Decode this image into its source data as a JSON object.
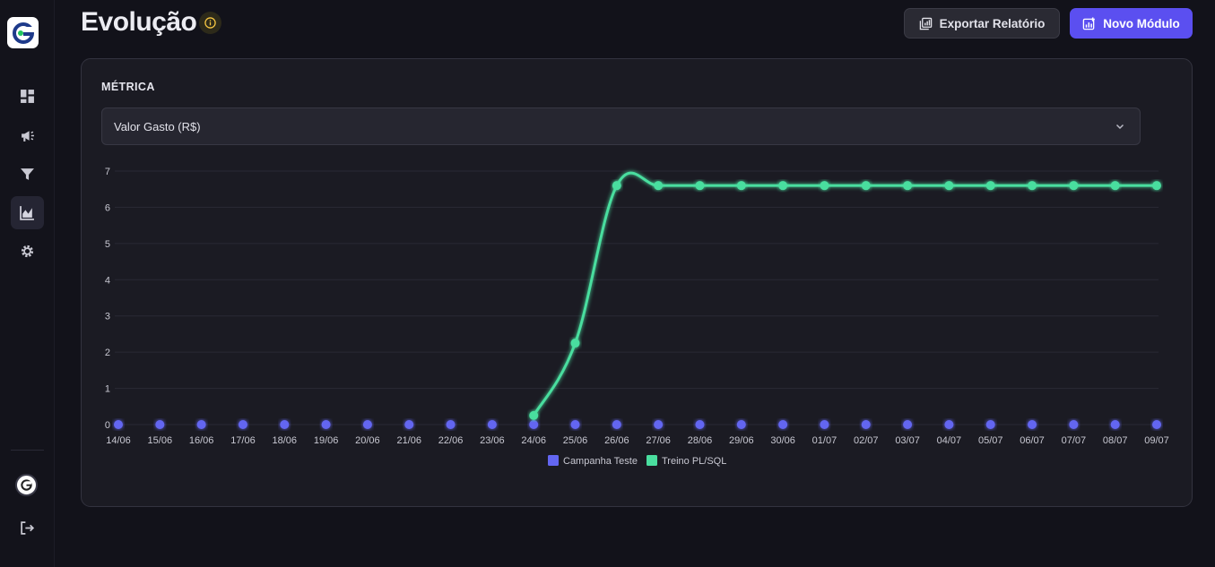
{
  "app": {
    "logo_letter": "G"
  },
  "sidebar": {
    "items": [
      {
        "icon": "dashboard-icon",
        "active": false
      },
      {
        "icon": "megaphone-icon",
        "active": false
      },
      {
        "icon": "filter-icon",
        "active": false
      },
      {
        "icon": "chart-area-icon",
        "active": true
      },
      {
        "icon": "gear-icon",
        "active": false
      }
    ],
    "avatar_letter": "G",
    "logout_icon": "logout-icon"
  },
  "header": {
    "title": "Evolução",
    "export_label": "Exportar Relatório",
    "new_module_label": "Novo Módulo"
  },
  "metric": {
    "label": "MÉTRICA",
    "selected": "Valor Gasto (R$)"
  },
  "colors": {
    "accent": "#5b4ff0",
    "series_campaign": "#6366f1",
    "series_training": "#4ade9f"
  },
  "chart_data": {
    "type": "line",
    "categories": [
      "14/06",
      "15/06",
      "16/06",
      "17/06",
      "18/06",
      "19/06",
      "20/06",
      "21/06",
      "22/06",
      "23/06",
      "24/06",
      "25/06",
      "26/06",
      "27/06",
      "28/06",
      "29/06",
      "30/06",
      "01/07",
      "02/07",
      "03/07",
      "04/07",
      "05/07",
      "06/07",
      "07/07",
      "08/07",
      "09/07"
    ],
    "series": [
      {
        "name": "Campanha Teste",
        "color": "#6366f1",
        "values": [
          0,
          0,
          0,
          0,
          0,
          0,
          0,
          0,
          0,
          0,
          0,
          0,
          0,
          0,
          0,
          0,
          0,
          0,
          0,
          0,
          0,
          0,
          0,
          0,
          0,
          0
        ]
      },
      {
        "name": "Treino PL/SQL",
        "color": "#4ade9f",
        "values": [
          null,
          null,
          null,
          null,
          null,
          null,
          null,
          null,
          null,
          null,
          0.25,
          2.25,
          6.6,
          6.6,
          6.6,
          6.6,
          6.6,
          6.6,
          6.6,
          6.6,
          6.6,
          6.6,
          6.6,
          6.6,
          6.6,
          6.6
        ]
      }
    ],
    "yticks": [
      "0",
      "1",
      "2",
      "3",
      "4",
      "5",
      "6",
      "7"
    ],
    "ylim": [
      0,
      7
    ],
    "grid": true,
    "legend": "bottom-center"
  }
}
